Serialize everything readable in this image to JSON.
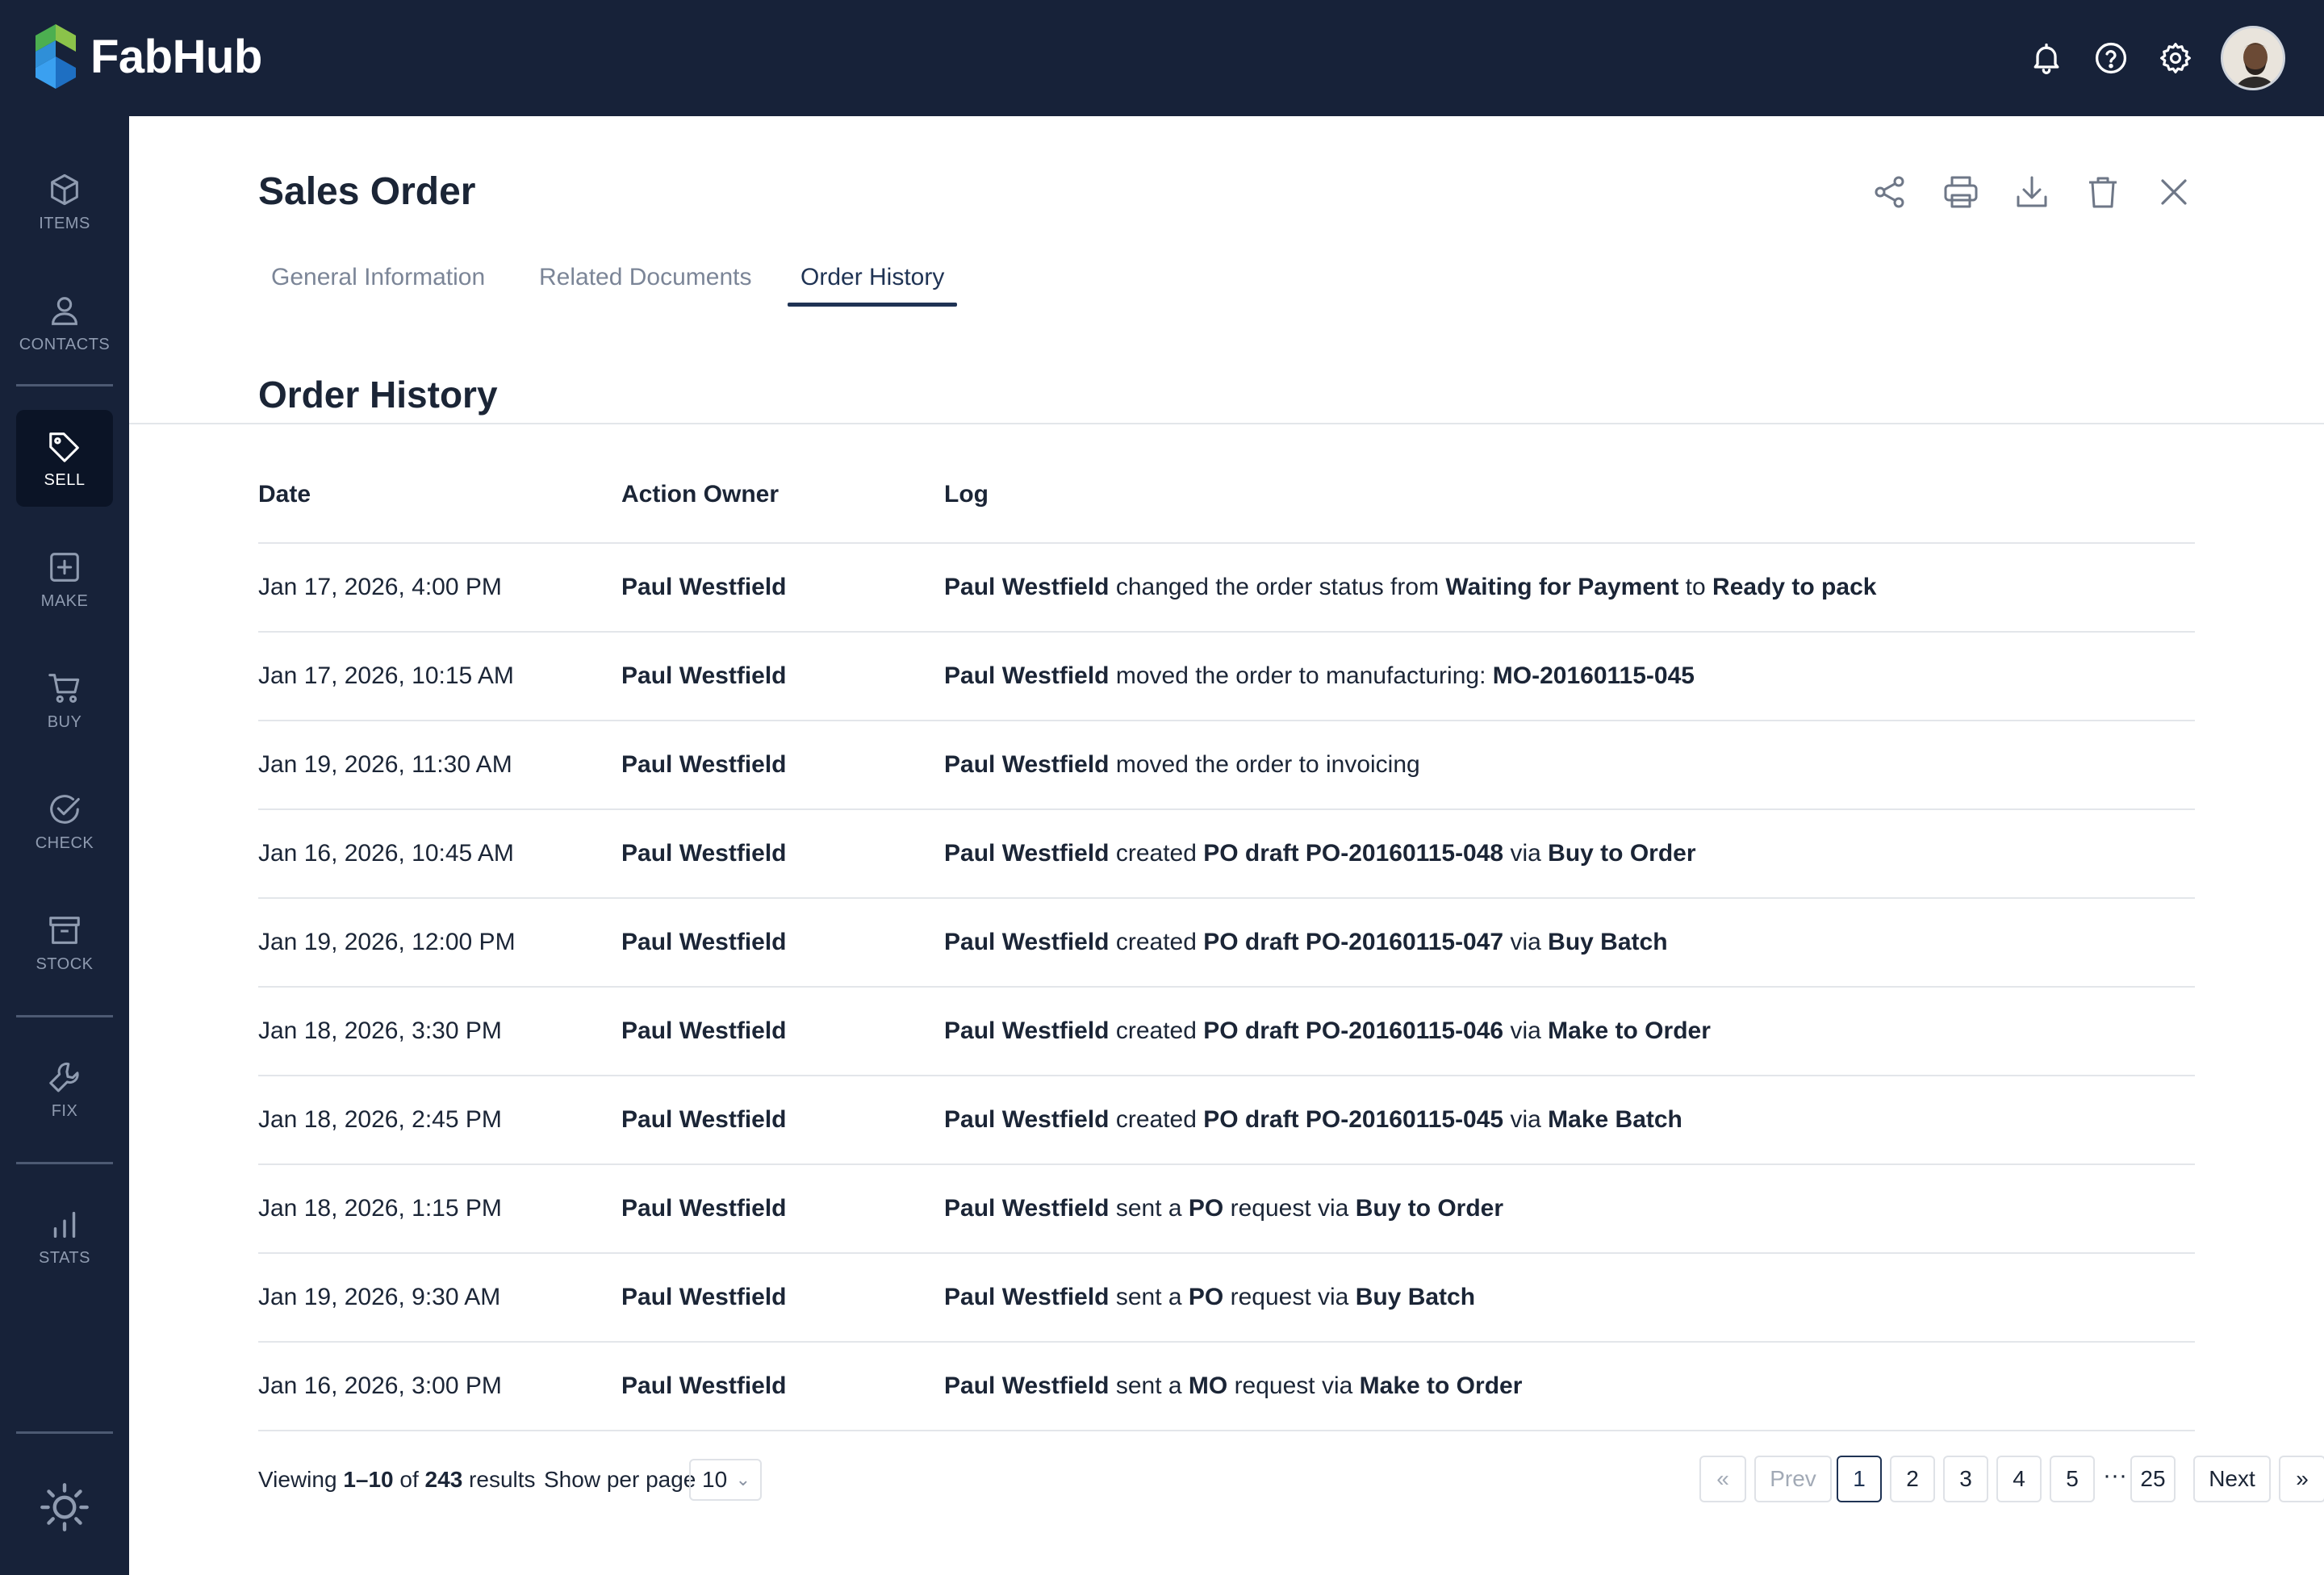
{
  "app": {
    "brand": "FabHub"
  },
  "topbar": {
    "icons": [
      "bell-icon",
      "help-icon",
      "settings-icon"
    ],
    "avatar": "user-avatar"
  },
  "sidebar": {
    "items": [
      {
        "label": "ITEMS",
        "icon": "cube-icon",
        "active": false
      },
      {
        "label": "CONTACTS",
        "icon": "person-icon",
        "active": false
      },
      {
        "label": "SELL",
        "icon": "tag-icon",
        "active": true
      },
      {
        "label": "MAKE",
        "icon": "plus-square-icon",
        "active": false
      },
      {
        "label": "BUY",
        "icon": "cart-icon",
        "active": false
      },
      {
        "label": "CHECK",
        "icon": "check-circle-icon",
        "active": false
      },
      {
        "label": "STOCK",
        "icon": "archive-icon",
        "active": false
      },
      {
        "label": "FIX",
        "icon": "wrench-icon",
        "active": false
      },
      {
        "label": "STATS",
        "icon": "bar-chart-icon",
        "active": false
      }
    ],
    "bottom_icon": "sun-icon"
  },
  "page": {
    "title": "Sales Order",
    "actions": [
      "share-icon",
      "print-icon",
      "download-icon",
      "trash-icon",
      "close-icon"
    ]
  },
  "tabs": [
    {
      "label": "General Information",
      "active": false
    },
    {
      "label": "Related Documents",
      "active": false
    },
    {
      "label": "Order History",
      "active": true
    }
  ],
  "history": {
    "title": "Order History",
    "columns": [
      "Date",
      "Action Owner",
      "Log"
    ],
    "rows": [
      {
        "date": "Jan 17, 2026, 4:00 PM",
        "owner": "Paul Westfield",
        "log": [
          [
            "b",
            "Paul Westfield"
          ],
          [
            "t",
            " changed the order status from "
          ],
          [
            "b",
            "Waiting for Payment"
          ],
          [
            "t",
            " to "
          ],
          [
            "b",
            "Ready to pack"
          ]
        ]
      },
      {
        "date": "Jan 17, 2026, 10:15 AM",
        "owner": "Paul Westfield",
        "log": [
          [
            "b",
            "Paul Westfield"
          ],
          [
            "t",
            " moved the order to manufacturing: "
          ],
          [
            "b",
            "MO-20160115-045"
          ]
        ]
      },
      {
        "date": "Jan 19, 2026, 11:30 AM",
        "owner": "Paul Westfield",
        "log": [
          [
            "b",
            "Paul Westfield"
          ],
          [
            "t",
            " moved the order to invoicing"
          ]
        ]
      },
      {
        "date": "Jan 16, 2026, 10:45 AM",
        "owner": "Paul Westfield",
        "log": [
          [
            "b",
            "Paul Westfield"
          ],
          [
            "t",
            " created "
          ],
          [
            "b",
            "PO draft PO-20160115-048"
          ],
          [
            "t",
            " via "
          ],
          [
            "b",
            "Buy to Order"
          ]
        ]
      },
      {
        "date": "Jan 19, 2026, 12:00 PM",
        "owner": "Paul Westfield",
        "log": [
          [
            "b",
            "Paul Westfield"
          ],
          [
            "t",
            " created "
          ],
          [
            "b",
            "PO draft PO-20160115-047"
          ],
          [
            "t",
            " via "
          ],
          [
            "b",
            "Buy Batch"
          ]
        ]
      },
      {
        "date": "Jan 18, 2026, 3:30 PM",
        "owner": "Paul Westfield",
        "log": [
          [
            "b",
            "Paul Westfield"
          ],
          [
            "t",
            " created "
          ],
          [
            "b",
            "PO draft PO-20160115-046"
          ],
          [
            "t",
            " via "
          ],
          [
            "b",
            "Make to Order"
          ]
        ]
      },
      {
        "date": "Jan 18, 2026, 2:45 PM",
        "owner": "Paul Westfield",
        "log": [
          [
            "b",
            "Paul Westfield"
          ],
          [
            "t",
            " created "
          ],
          [
            "b",
            "PO draft PO-20160115-045"
          ],
          [
            "t",
            " via "
          ],
          [
            "b",
            "Make Batch"
          ]
        ]
      },
      {
        "date": "Jan 18, 2026, 1:15 PM",
        "owner": "Paul Westfield",
        "log": [
          [
            "b",
            "Paul Westfield"
          ],
          [
            "t",
            " sent a "
          ],
          [
            "b",
            "PO"
          ],
          [
            "t",
            " request via "
          ],
          [
            "b",
            "Buy to Order"
          ]
        ]
      },
      {
        "date": "Jan 19, 2026, 9:30 AM",
        "owner": "Paul Westfield",
        "log": [
          [
            "b",
            "Paul Westfield"
          ],
          [
            "t",
            " sent a "
          ],
          [
            "b",
            "PO"
          ],
          [
            "t",
            " request via "
          ],
          [
            "b",
            "Buy Batch"
          ]
        ]
      },
      {
        "date": "Jan 16, 2026, 3:00 PM",
        "owner": "Paul Westfield",
        "log": [
          [
            "b",
            "Paul Westfield"
          ],
          [
            "t",
            " sent a "
          ],
          [
            "b",
            "MO"
          ],
          [
            "t",
            " request via "
          ],
          [
            "b",
            "Make to Order"
          ]
        ]
      }
    ]
  },
  "footer": {
    "viewing_prefix": "Viewing ",
    "viewing_range": "1–10",
    "viewing_of": " of ",
    "viewing_total": "243",
    "viewing_suffix": " results",
    "per_page_label": "Show per page",
    "per_page_value": "10",
    "pagination": {
      "first": "«",
      "prev": "Prev",
      "pages": [
        "1",
        "2",
        "3",
        "4",
        "5"
      ],
      "ellipsis": "···",
      "last_page": "25",
      "next": "Next",
      "last": "»",
      "current": "1"
    }
  }
}
